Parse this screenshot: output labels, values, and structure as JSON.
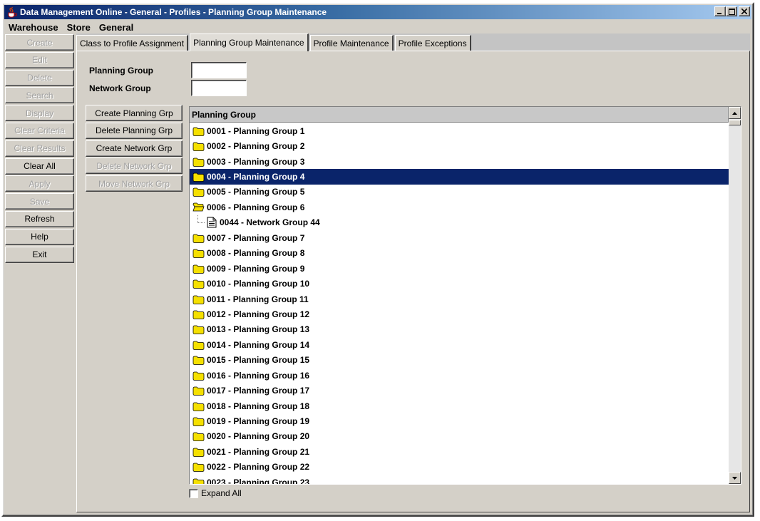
{
  "window": {
    "title": "Data Management Online - General - Profiles - Planning Group Maintenance",
    "controls": {
      "minimize": "_",
      "maximize": "□",
      "close": "×"
    }
  },
  "menu": [
    "Warehouse",
    "Store",
    "General"
  ],
  "sidebar": {
    "buttons": [
      {
        "label": "Create",
        "enabled": false
      },
      {
        "label": "Edit",
        "enabled": false
      },
      {
        "label": "Delete",
        "enabled": false
      },
      {
        "label": "Search",
        "enabled": false
      },
      {
        "label": "Display",
        "enabled": false
      },
      {
        "label": "Clear Criteria",
        "enabled": false
      },
      {
        "label": "Clear Results",
        "enabled": false
      },
      {
        "label": "Clear All",
        "enabled": true
      },
      {
        "label": "Apply",
        "enabled": false
      },
      {
        "label": "Save",
        "enabled": false
      },
      {
        "label": "Refresh",
        "enabled": true
      },
      {
        "label": "Help",
        "enabled": true
      },
      {
        "label": "Exit",
        "enabled": true
      }
    ]
  },
  "tabs": [
    {
      "label": "Class to Profile Assignment",
      "active": false
    },
    {
      "label": "Planning Group Maintenance",
      "active": true
    },
    {
      "label": "Profile Maintenance",
      "active": false
    },
    {
      "label": "Profile Exceptions",
      "active": false
    }
  ],
  "form": {
    "planning_group_label": "Planning Group",
    "planning_group_value": "",
    "network_group_label": "Network Group",
    "network_group_value": ""
  },
  "actions": [
    {
      "label": "Create Planning Grp",
      "enabled": true
    },
    {
      "label": "Delete Planning Grp",
      "enabled": true
    },
    {
      "label": "Create Network Grp",
      "enabled": true
    },
    {
      "label": "Delete Network Grp",
      "enabled": false
    },
    {
      "label": "Move Network Grp",
      "enabled": false
    }
  ],
  "tree": {
    "header": "Planning Group",
    "rows": [
      {
        "label": "0001 - Planning Group 1",
        "type": "folder"
      },
      {
        "label": "0002 - Planning Group 2",
        "type": "folder"
      },
      {
        "label": "0003 - Planning Group 3",
        "type": "folder"
      },
      {
        "label": "0004 - Planning Group 4",
        "type": "folder",
        "selected": true
      },
      {
        "label": "0005 - Planning Group 5",
        "type": "folder"
      },
      {
        "label": "0006 - Planning Group 6",
        "type": "folder-open"
      },
      {
        "label": "0044 - Network Group 44",
        "type": "doc"
      },
      {
        "label": "0007 - Planning Group 7",
        "type": "folder"
      },
      {
        "label": "0008 - Planning Group 8",
        "type": "folder"
      },
      {
        "label": "0009 - Planning Group 9",
        "type": "folder"
      },
      {
        "label": "0010 - Planning Group 10",
        "type": "folder"
      },
      {
        "label": "0011 - Planning Group 11",
        "type": "folder"
      },
      {
        "label": "0012 - Planning Group 12",
        "type": "folder"
      },
      {
        "label": "0013 - Planning Group 13",
        "type": "folder"
      },
      {
        "label": "0014 - Planning Group 14",
        "type": "folder"
      },
      {
        "label": "0015 - Planning Group 15",
        "type": "folder"
      },
      {
        "label": "0016 - Planning Group 16",
        "type": "folder"
      },
      {
        "label": "0017 - Planning Group 17",
        "type": "folder"
      },
      {
        "label": "0018 - Planning Group 18",
        "type": "folder"
      },
      {
        "label": "0019 - Planning Group 19",
        "type": "folder"
      },
      {
        "label": "0020 - Planning Group 20",
        "type": "folder"
      },
      {
        "label": "0021 - Planning Group 21",
        "type": "folder"
      },
      {
        "label": "0022 - Planning Group 22",
        "type": "folder"
      },
      {
        "label": "0023 - Planning Group 23",
        "type": "folder"
      }
    ]
  },
  "expand_all_label": "Expand All",
  "expand_all_checked": false,
  "colors": {
    "selection": "#0a246a",
    "folder": "#f5e000",
    "face": "#d4d0c8"
  }
}
